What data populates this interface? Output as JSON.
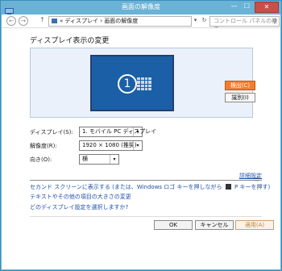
{
  "window": {
    "title": "画面の解像度",
    "minimize_glyph": "—",
    "maximize_glyph": "☐",
    "close_glyph": "✕"
  },
  "navbar": {
    "back_glyph": "←",
    "forward_glyph": "→",
    "up_glyph": "↑",
    "breadcrumb": "« ディスプレイ › 画面の解像度",
    "dropdown_glyph": "▾",
    "refresh_glyph": "↻",
    "search_placeholder": "コントロール パネルの検索",
    "search_glyph": "⚲"
  },
  "main": {
    "page_title": "ディスプレイ表示の変更",
    "monitor_number": "1",
    "detect_label": "検出(C)",
    "identify_label": "識別(I)",
    "display_label": "ディスプレイ(S):",
    "display_value": "1. モバイル PC ディスプレイ",
    "resolution_label": "解像度(R):",
    "resolution_value": "1920 × 1080 (推奨)",
    "orientation_label": "向き(O):",
    "orientation_value": "横",
    "select_arrow_glyph": "▾",
    "advanced_label": "詳細設定",
    "cursor_glyph": "☝"
  },
  "links": {
    "second_screen_before": "セカンド スクリーンに表示する (または、Windows ロゴ キーを押しながら",
    "second_screen_after": "P キーを押す)",
    "text_size": "テキストやその他の項目の大きさの変更",
    "which_settings": "どのディスプレイ設定を選択しますか?"
  },
  "buttons": {
    "ok_label": "OK",
    "cancel_label": "キャンセル",
    "apply_label": "適用(A)"
  },
  "colors": {
    "titlebar": "#6ab2d6",
    "close": "#c7504b",
    "detect": "#f47c2c",
    "monitor": "#1b5fa7",
    "link": "#1f4fa8"
  }
}
